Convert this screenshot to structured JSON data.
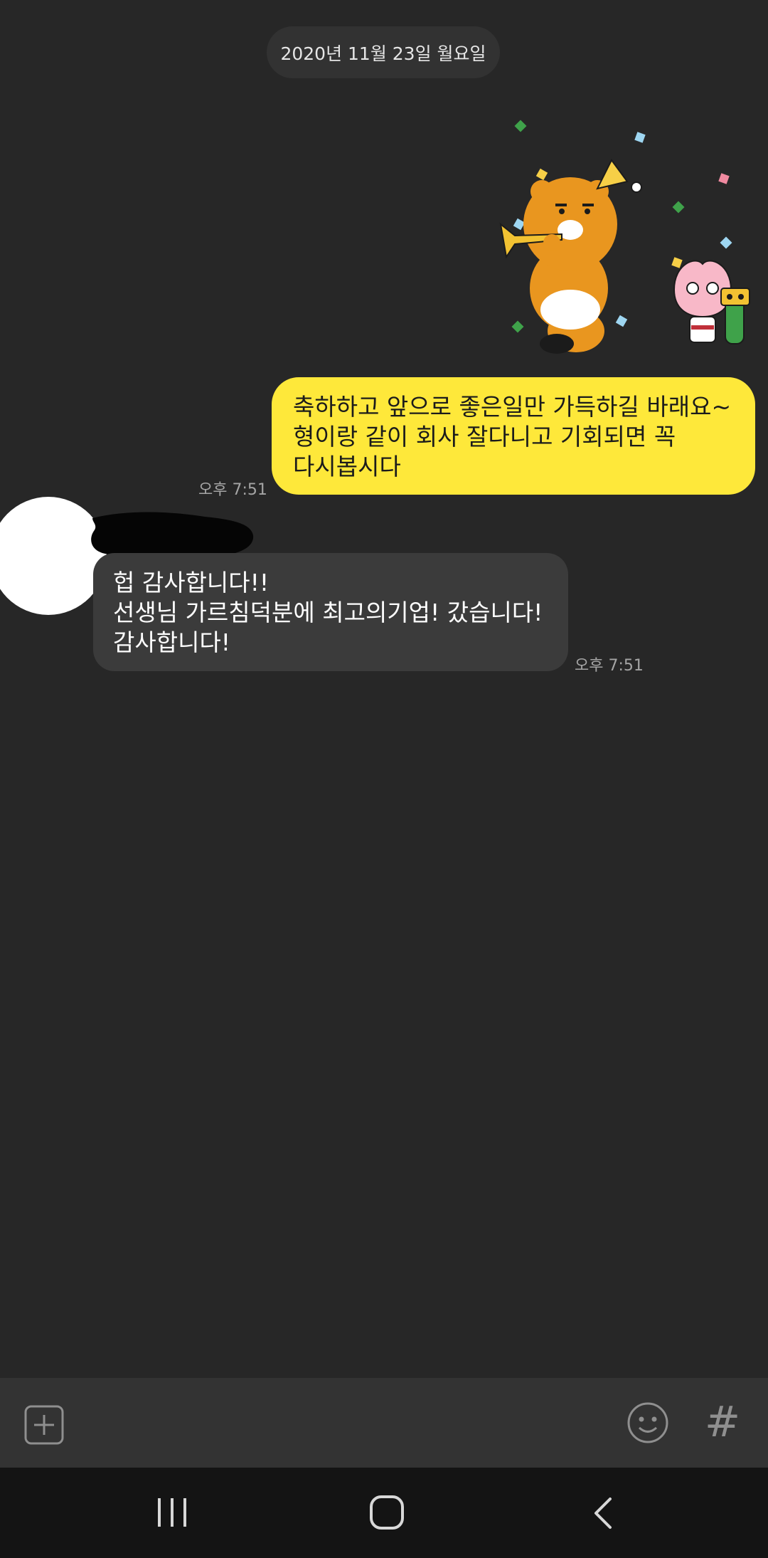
{
  "date_divider": "2020년 11월 23일 월요일",
  "messages": [
    {
      "direction": "outgoing",
      "type": "sticker",
      "sticker": "kakao-ryan-trumpet-celebration"
    },
    {
      "direction": "outgoing",
      "type": "text",
      "text": "축하하고 앞으로 좋은일만 가득하길 바래요~\n형이랑 같이 회사 잘다니고 기회되면 꼭\n다시봅시다",
      "time": "오후 7:51"
    },
    {
      "direction": "incoming",
      "type": "text",
      "text": "헙 감사합니다!!\n선생님 가르침덕분에 최고의기업! 갔습니다!\n감사합니다!",
      "time": "오후 7:51"
    }
  ],
  "input_bar": {
    "icons": [
      "plus-square-icon",
      "emoticon-icon",
      "hashtag-icon"
    ],
    "hash_symbol": "#"
  },
  "nav_bar": {
    "icons": [
      "recent-apps-icon",
      "home-icon",
      "back-icon"
    ]
  },
  "colors": {
    "background": "#272727",
    "outgoing_bubble": "#fee83a",
    "incoming_bubble": "#3b3b3b",
    "input_bar": "#333333",
    "nav_bar": "#141414"
  }
}
